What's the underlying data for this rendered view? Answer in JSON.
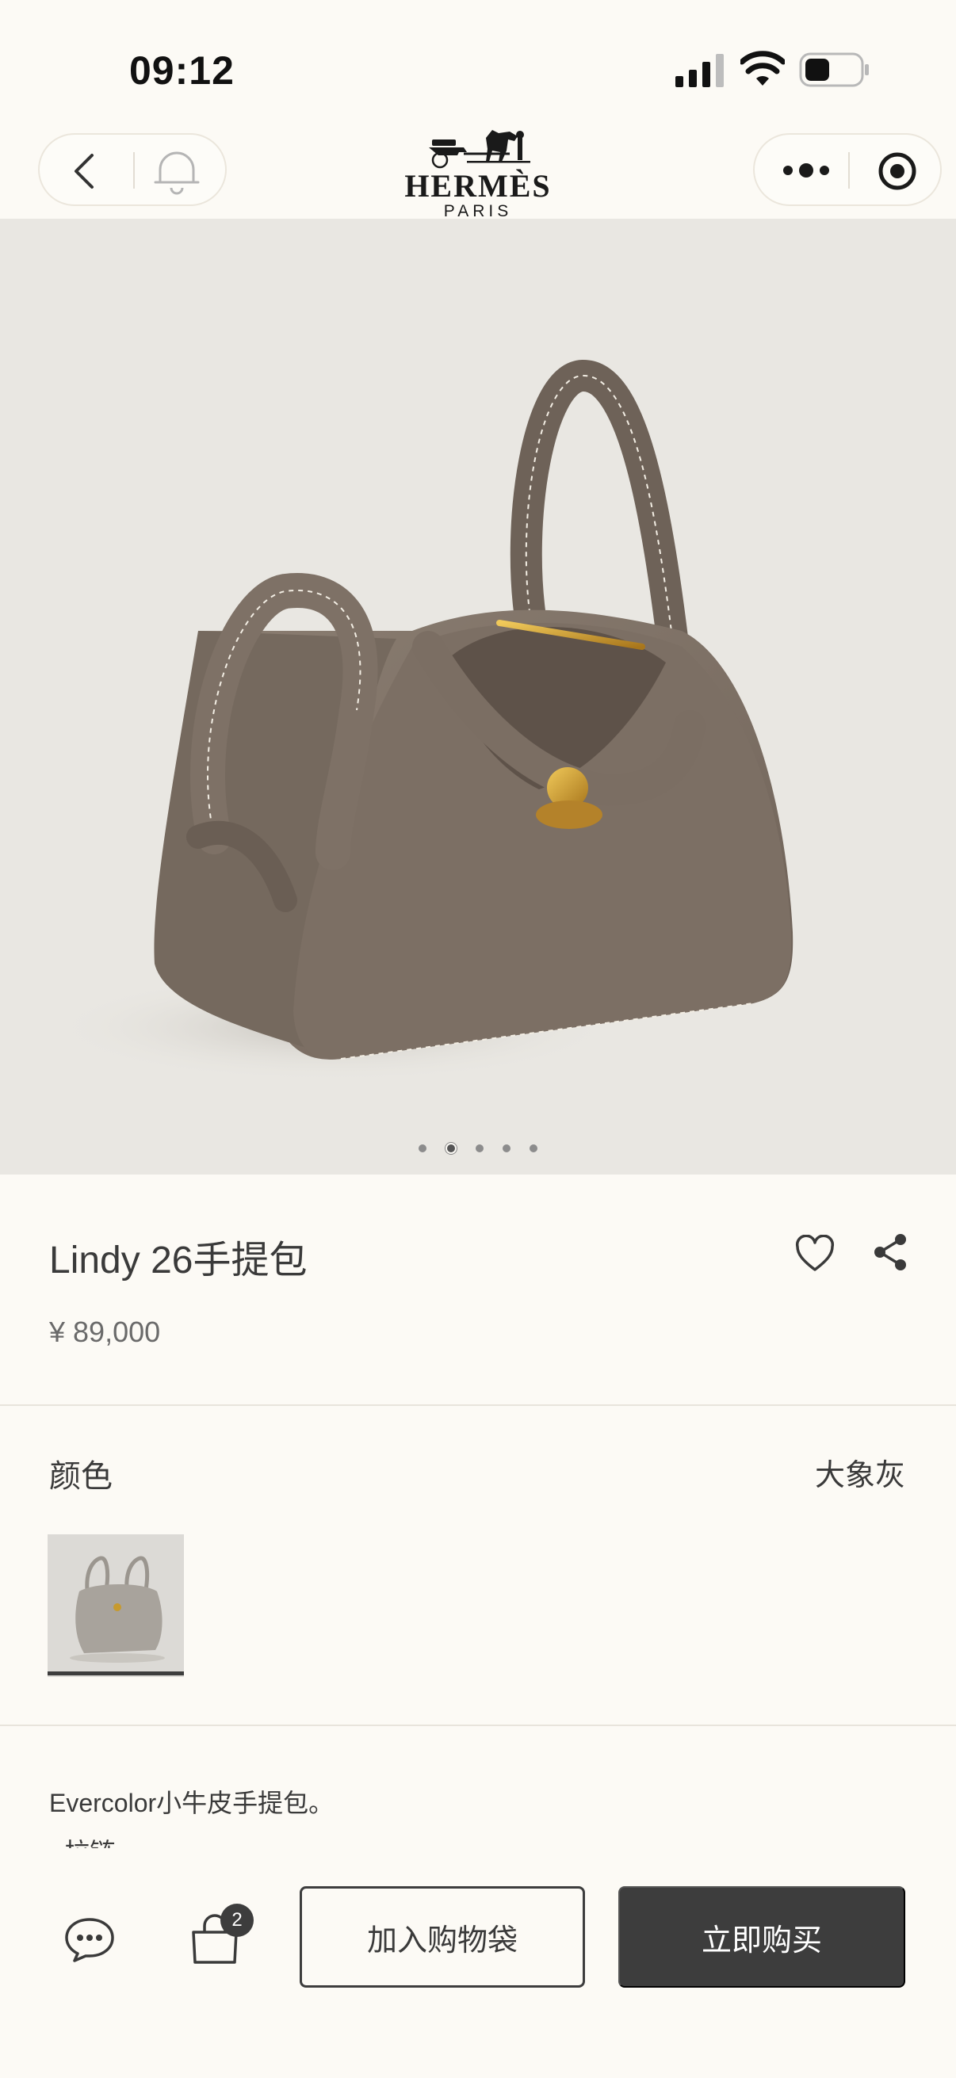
{
  "status_bar": {
    "time": "09:12"
  },
  "brand": {
    "name": "HERMÈS",
    "city": "PARIS"
  },
  "gallery": {
    "image_count": 5,
    "active_index": 1
  },
  "product": {
    "title": "Lindy 26手提包",
    "price": "¥ 89,000",
    "color_label": "颜色",
    "color_value": "大象灰",
    "description": "Evercolor小牛皮手提包。",
    "feature_partial": "- 拉链"
  },
  "bottom_bar": {
    "cart_count": "2",
    "add_to_bag_label": "加入购物袋",
    "buy_now_label": "立即购买"
  },
  "colors": {
    "background": "#fcfaf5",
    "hero_background": "#e9e7e2",
    "bag_leather": "#7b6e63",
    "primary_button": "#3d3d3d",
    "hardware_gold": "#c79a2e"
  }
}
